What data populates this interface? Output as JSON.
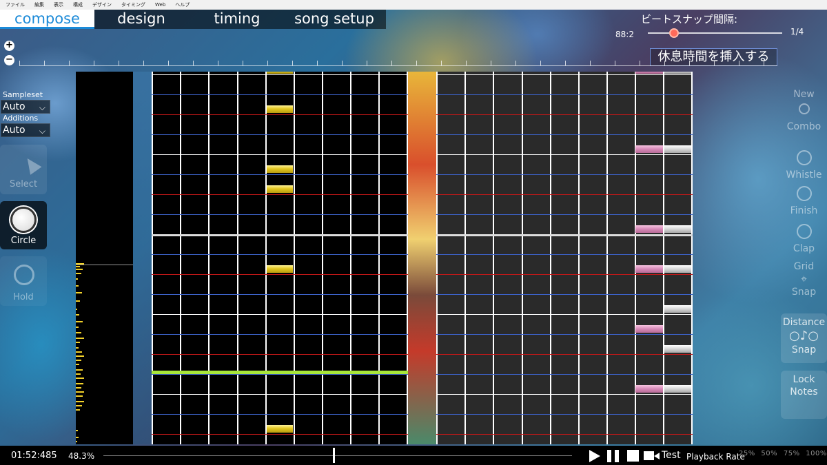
{
  "menu": [
    "ファイル",
    "編集",
    "表示",
    "構成",
    "デザイン",
    "タイミング",
    "Web",
    "ヘルプ"
  ],
  "tabs": [
    {
      "label": "compose",
      "active": true
    },
    {
      "label": "design",
      "active": false
    },
    {
      "label": "timing",
      "active": false
    },
    {
      "label": "song setup",
      "active": false
    }
  ],
  "beat_snap": {
    "title": "ビートスナップ間隔:",
    "left_value": "88:2",
    "right_value": "1/4"
  },
  "insert_break_label": "休息時間を挿入する",
  "zoom": {
    "in_symbol": "+",
    "out_symbol": "−"
  },
  "left_panel": {
    "sampleset_label": "Sampleset",
    "sampleset_value": "Auto",
    "additions_label": "Additions",
    "additions_value": "Auto",
    "tools": [
      {
        "label": "Select",
        "active": false
      },
      {
        "label": "Circle",
        "active": true
      },
      {
        "label": "Hold",
        "active": false
      }
    ]
  },
  "right_panel": {
    "items": [
      "New",
      "Combo",
      "Whistle",
      "Finish",
      "Clap",
      "Grid",
      "Snap",
      "Distance",
      "Snap",
      "Lock",
      "Notes"
    ]
  },
  "bottom": {
    "time": "01:52:485",
    "percent": "48.3%",
    "test_label": "Test",
    "playback_rate_label": "Playback Rate",
    "rate_options": [
      "25%",
      "50%",
      "75%",
      "100%"
    ]
  },
  "colors": {
    "tab_active": "#1b8ad8",
    "cursor_line": "#a8e63a",
    "note_yellow": "#e3c720",
    "note_pink": "#d78ab8",
    "beat_blue": "#3c62c8",
    "beat_red": "#c21818"
  }
}
